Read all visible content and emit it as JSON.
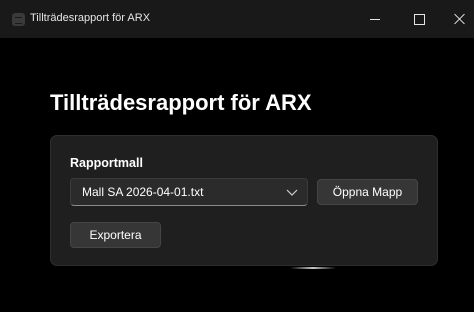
{
  "window": {
    "title": "Tillträdesrapport för ARX",
    "app_icon": "app-logo-icon",
    "controls": [
      "minimize-icon",
      "maximize-icon",
      "close-icon"
    ]
  },
  "main": {
    "heading": "Tillträdesrapport för ARX",
    "template_label": "Rapportmall",
    "template_select": {
      "value": "Mall SA 2026-04-01.txt",
      "icon": "chevron-down-icon"
    },
    "open_folder_label": "Öppna Mapp",
    "export_label": "Exportera"
  },
  "colors": {
    "background": "#000000",
    "titlebar": "#191919",
    "card": "#1f1f1f",
    "button": "#363636",
    "text": "#ffffff"
  }
}
